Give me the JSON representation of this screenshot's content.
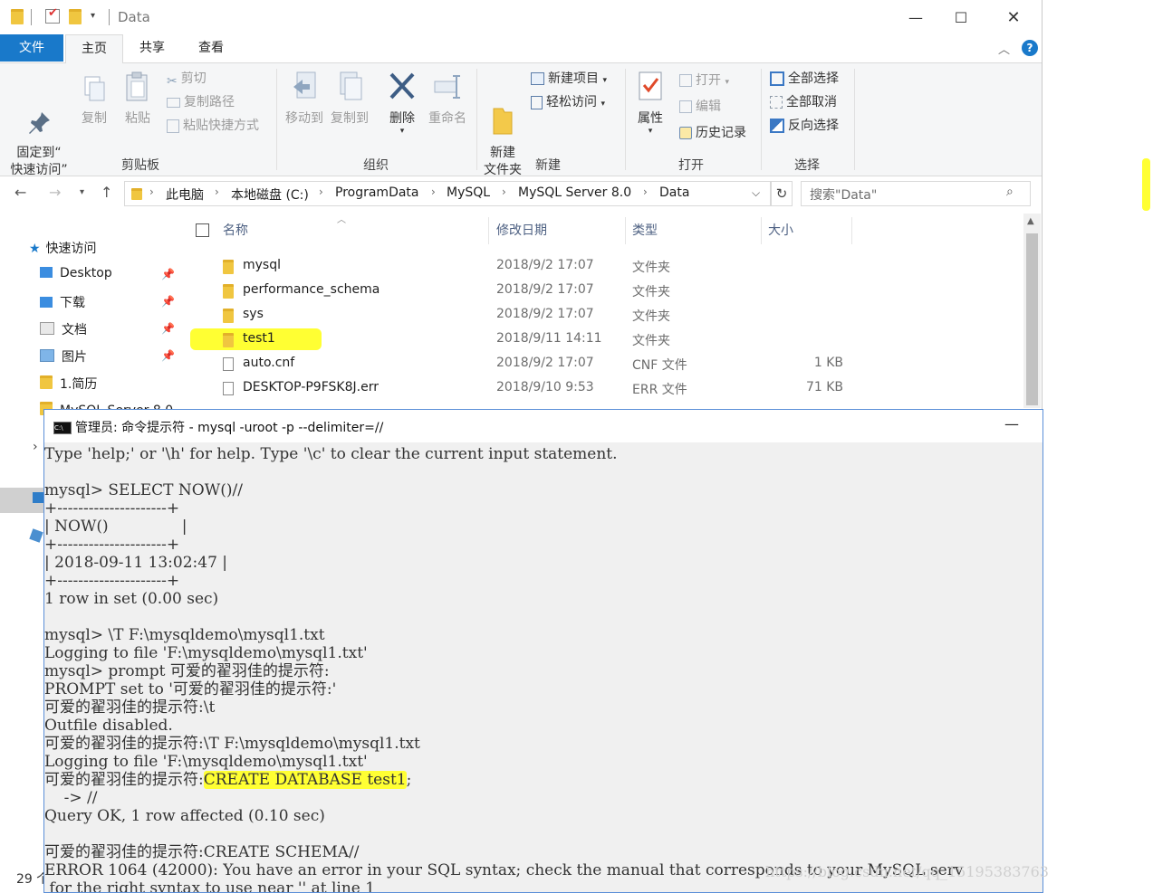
{
  "explorer": {
    "window_title": "Data",
    "ribbon_tabs": {
      "file": "文件",
      "home": "主页",
      "share": "共享",
      "view": "查看"
    },
    "clipboard": {
      "pin": "固定到“\n快速访问”",
      "copy": "复制",
      "paste": "粘贴",
      "cut": "剪切",
      "copy_path": "复制路径",
      "paste_shortcut": "粘贴快捷方式",
      "label": "剪贴板"
    },
    "organize": {
      "move_to": "移动到",
      "copy_to": "复制到",
      "delete": "删除",
      "rename": "重命名",
      "label": "组织"
    },
    "new": {
      "new_folder": "新建\n文件夹",
      "new_item": "新建项目",
      "easy_access": "轻松访问",
      "label": "新建"
    },
    "open": {
      "properties": "属性",
      "open": "打开",
      "edit": "编辑",
      "history": "历史记录",
      "label": "打开"
    },
    "select": {
      "select_all": "全部选择",
      "select_none": "全部取消",
      "invert": "反向选择",
      "label": "选择"
    },
    "breadcrumbs": [
      "此电脑",
      "本地磁盘 (C:)",
      "ProgramData",
      "MySQL",
      "MySQL Server 8.0",
      "Data"
    ],
    "search_placeholder": "搜索\"Data\"",
    "nav_items": [
      {
        "label": "快速访问"
      },
      {
        "label": "Desktop"
      },
      {
        "label": "下载"
      },
      {
        "label": "文档"
      },
      {
        "label": "图片"
      },
      {
        "label": "1.简历"
      },
      {
        "label": "MySQL Server 8.0"
      }
    ],
    "columns": {
      "name": "名称",
      "modified": "修改日期",
      "type": "类型",
      "size": "大小"
    },
    "files": [
      {
        "name": "mysql",
        "modified": "2018/9/2 17:07",
        "type": "文件夹",
        "size": "",
        "kind": "folder",
        "highlight": false
      },
      {
        "name": "performance_schema",
        "modified": "2018/9/2 17:07",
        "type": "文件夹",
        "size": "",
        "kind": "folder",
        "highlight": false
      },
      {
        "name": "sys",
        "modified": "2018/9/2 17:07",
        "type": "文件夹",
        "size": "",
        "kind": "folder",
        "highlight": false
      },
      {
        "name": "test1",
        "modified": "2018/9/11 14:11",
        "type": "文件夹",
        "size": "",
        "kind": "folder",
        "highlight": true
      },
      {
        "name": "auto.cnf",
        "modified": "2018/9/2 17:07",
        "type": "CNF 文件",
        "size": "1 KB",
        "kind": "file",
        "highlight": false
      },
      {
        "name": "DESKTOP-P9FSK8J.err",
        "modified": "2018/9/10 9:53",
        "type": "ERR 文件",
        "size": "71 KB",
        "kind": "file",
        "highlight": false
      }
    ],
    "status_count": "29 个"
  },
  "cmd": {
    "title": "管理员: 命令提示符 - mysql  -uroot -p --delimiter=//",
    "lines": [
      "Type 'help;' or '\\h' for help. Type '\\c' to clear the current input statement.",
      "",
      "mysql> SELECT NOW()//",
      "+---------------------+",
      "| NOW()               |",
      "+---------------------+",
      "| 2018-09-11 13:02:47 |",
      "+---------------------+",
      "1 row in set (0.00 sec)",
      "",
      "mysql> \\T F:\\mysqldemo\\mysql1.txt",
      "Logging to file 'F:\\mysqldemo\\mysql1.txt'",
      "mysql> prompt 可爱的翟羽佳的提示符:",
      "PROMPT set to '可爱的翟羽佳的提示符:'",
      "可爱的翟羽佳的提示符:\\t",
      "Outfile disabled.",
      "可爱的翟羽佳的提示符:\\T F:\\mysqldemo\\mysql1.txt",
      "Logging to file 'F:\\mysqldemo\\mysql1.txt'",
      "可爱的翟羽佳的提示符:",
      "    -> //",
      "Query OK, 1 row affected (0.10 sec)",
      "",
      "可爱的翟羽佳的提示符:CREATE SCHEMA//",
      "ERROR 1064 (42000): You have an error in your SQL syntax; check the manual that corresponds to your MySQL serv",
      " for the right syntax to use near '' at line 1"
    ],
    "highlighted_command": "CREATE DATABASE test1",
    "highlighted_suffix": ";"
  },
  "watermark": "https://blog.csdn.net/qq_15195383763",
  "colors": {
    "highlight": "#ffff33",
    "file_tab": "#1979ca",
    "folder": "#f0c640"
  }
}
